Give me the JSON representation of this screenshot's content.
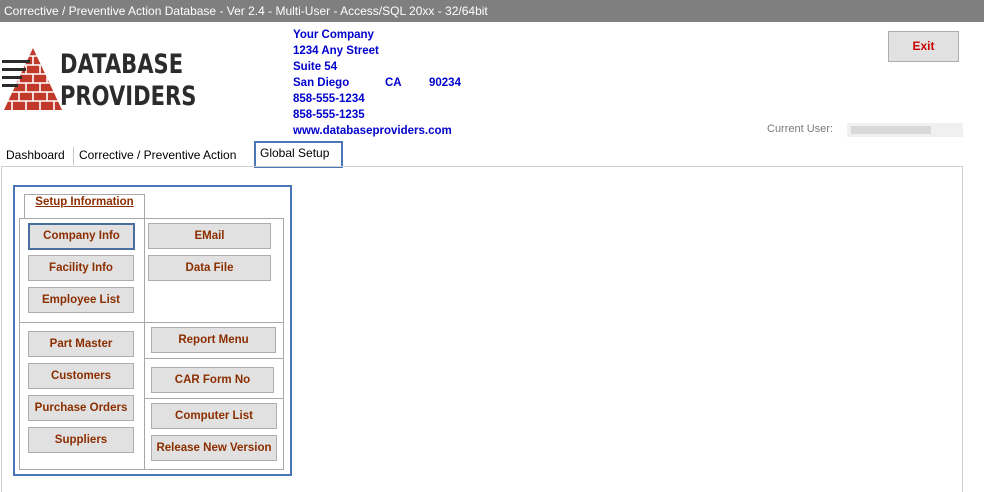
{
  "window": {
    "title": "Corrective / Preventive Action Database - Ver 2.4  -  Multi-User  -  Access/SQL 20xx  -  32/64bit"
  },
  "logo": {
    "line1": "DATABASE",
    "line2": "PROVIDERS"
  },
  "company": {
    "name": "Your Company",
    "address1": "1234 Any Street",
    "address2": "Suite 54",
    "city": "San Diego",
    "state": "CA",
    "zip": "90234",
    "phone": "858-555-1234",
    "fax": "858-555-1235",
    "website": "www.databaseproviders.com"
  },
  "header": {
    "exit_label": "Exit",
    "current_user_label": "Current User:"
  },
  "tabs": [
    {
      "label": "Dashboard"
    },
    {
      "label": "Corrective / Preventive Action"
    },
    {
      "label": "Global Setup"
    }
  ],
  "setup": {
    "title": "Setup Information",
    "buttons": {
      "company_info": "Company Info",
      "facility_info": "Facility Info",
      "employee_list": "Employee List",
      "email": "EMail",
      "data_file": "Data File",
      "part_master": "Part Master",
      "customers": "Customers",
      "purchase_orders": "Purchase Orders",
      "suppliers": "Suppliers",
      "report_menu": "Report Menu",
      "car_form_no": "CAR  Form No",
      "computer_list": "Computer List",
      "release_new_version": "Release New Version"
    }
  },
  "colors": {
    "highlight": "#4a76b8",
    "button_text": "#8b2e00",
    "company_text": "#0000cc",
    "exit_text": "#cc0000"
  }
}
